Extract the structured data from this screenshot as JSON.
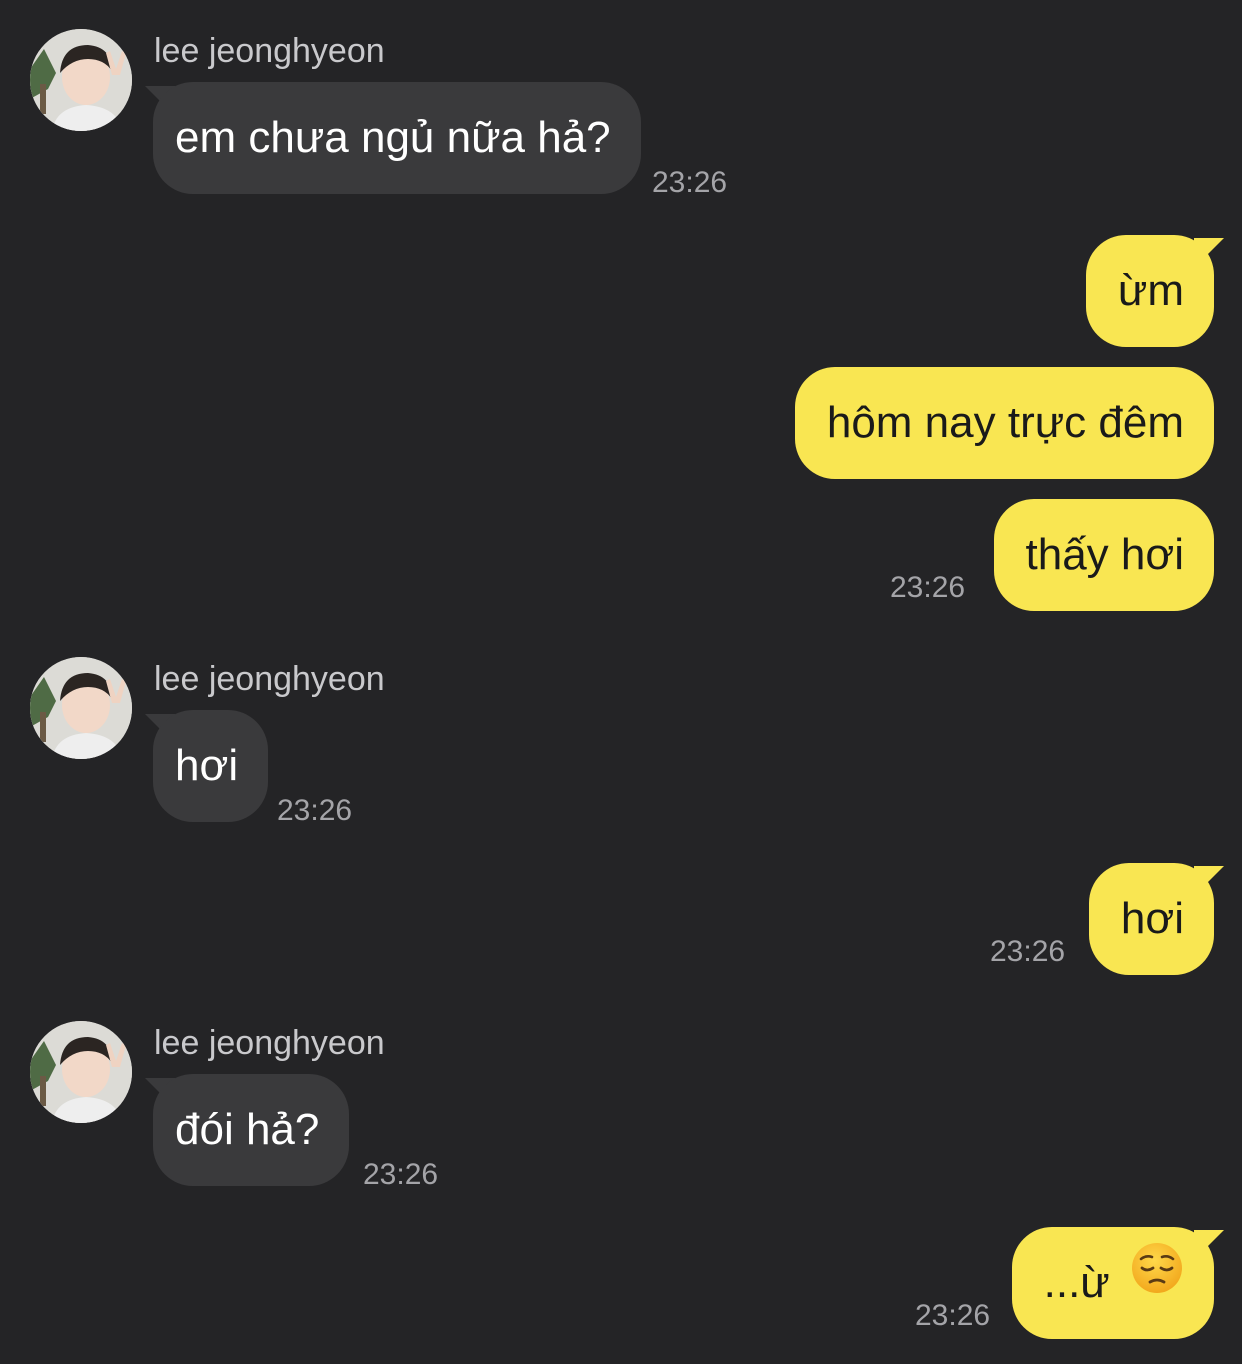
{
  "chat": {
    "sender_name": "lee jeonghyeon",
    "messages": [
      {
        "from": "them",
        "text": "em chưa ngủ nữa hả?",
        "time": "23:26"
      },
      {
        "from": "me",
        "text": "ừm"
      },
      {
        "from": "me",
        "text": "hôm nay trực đêm"
      },
      {
        "from": "me",
        "text": "thấy hơi",
        "time": "23:26"
      },
      {
        "from": "them",
        "text": "hơi",
        "time": "23:26"
      },
      {
        "from": "me",
        "text": "hơi",
        "time": "23:26"
      },
      {
        "from": "them",
        "text": "đói hả?",
        "time": "23:26"
      },
      {
        "from": "me",
        "text": "...ừ",
        "emoji": "pensive-face-emoji",
        "time": "23:26"
      }
    ]
  },
  "colors": {
    "background": "#242426",
    "incoming_bubble": "#3a3a3c",
    "outgoing_bubble": "#f9e652",
    "timestamp": "#a4a4a8",
    "sender_name": "#c9c9cc"
  }
}
